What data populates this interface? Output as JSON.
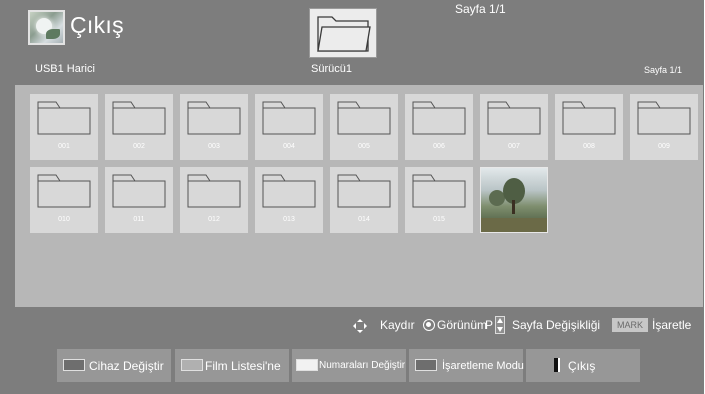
{
  "header": {
    "title": "Çıkış",
    "page_top": "Sayfa 1/1",
    "usb_label": "USB1 Harici",
    "drive_label": "Sürücü1",
    "page_small": "Sayfa 1/1"
  },
  "items": [
    {
      "label": "001",
      "type": "folder"
    },
    {
      "label": "002",
      "type": "folder"
    },
    {
      "label": "003",
      "type": "folder"
    },
    {
      "label": "004",
      "type": "folder"
    },
    {
      "label": "005",
      "type": "folder"
    },
    {
      "label": "006",
      "type": "folder"
    },
    {
      "label": "007",
      "type": "folder"
    },
    {
      "label": "008",
      "type": "folder"
    },
    {
      "label": "009",
      "type": "folder"
    },
    {
      "label": "010",
      "type": "folder"
    },
    {
      "label": "011",
      "type": "folder"
    },
    {
      "label": "012",
      "type": "folder"
    },
    {
      "label": "013",
      "type": "folder"
    },
    {
      "label": "014",
      "type": "folder"
    },
    {
      "label": "015",
      "type": "folder"
    },
    {
      "label": "",
      "type": "photo"
    }
  ],
  "hints": {
    "move": "Kaydır",
    "view": "Görünüm",
    "p_key": "P",
    "page_change": "Sayfa Değişikliği",
    "mark_key": "MARK",
    "mark": "İşaretle"
  },
  "buttons": [
    {
      "label": "Cihaz Değiştir",
      "color": "#6e6e6e"
    },
    {
      "label": "Film Listesi'ne",
      "color": "#b0b0b0"
    },
    {
      "label": "Numaraları Değiştir",
      "color": "#f2f2f2"
    },
    {
      "label": "İşaretleme Modu",
      "color": "#6e6e6e"
    },
    {
      "label": "Çıkış",
      "color": ""
    }
  ]
}
